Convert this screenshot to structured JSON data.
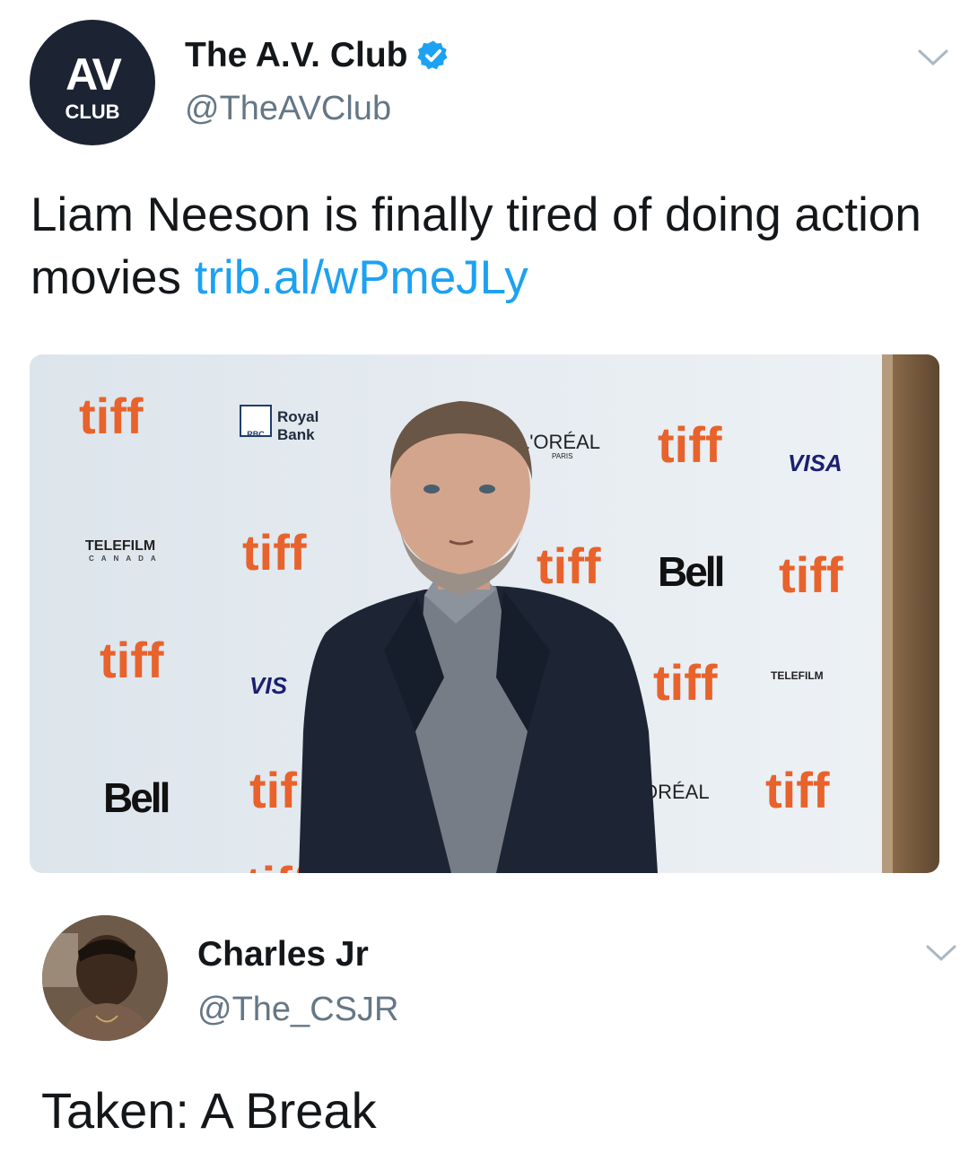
{
  "tweet": {
    "author": {
      "display_name": "The A.V. Club",
      "handle": "@TheAVClub",
      "avatar_text_top": "AV",
      "avatar_text_bottom": "CLUB",
      "verified": true
    },
    "text": "Liam Neeson is finally tired of doing action movies ",
    "link": "trib.al/wPmeJLy",
    "menu_icon": "chevron-down-icon",
    "media": {
      "icon": "photo",
      "logos": {
        "tiff": "tiff",
        "royal_bank_line1": "Royal",
        "royal_bank_line2": "Bank",
        "rbc": "RBC",
        "loreal": "L'ORÉAL",
        "loreal_sub": "PARIS",
        "visa": "VISA",
        "visa_partial": "VIS",
        "bell": "Bell",
        "telefilm": "TELEFILM",
        "telefilm_sub": "CANADA",
        "tiff_partial": "tif",
        "loreal_partial": "ORÉAL"
      }
    }
  },
  "reply": {
    "author": {
      "display_name": "Charles Jr",
      "handle": "@The_CSJR"
    },
    "text": "Taken: A Break",
    "menu_icon": "chevron-down-icon"
  },
  "colors": {
    "link": "#1da1f2",
    "verified": "#1da1f2",
    "handle": "#657786",
    "tiff_orange": "#e8622c",
    "backdrop": "#e9eef2"
  }
}
